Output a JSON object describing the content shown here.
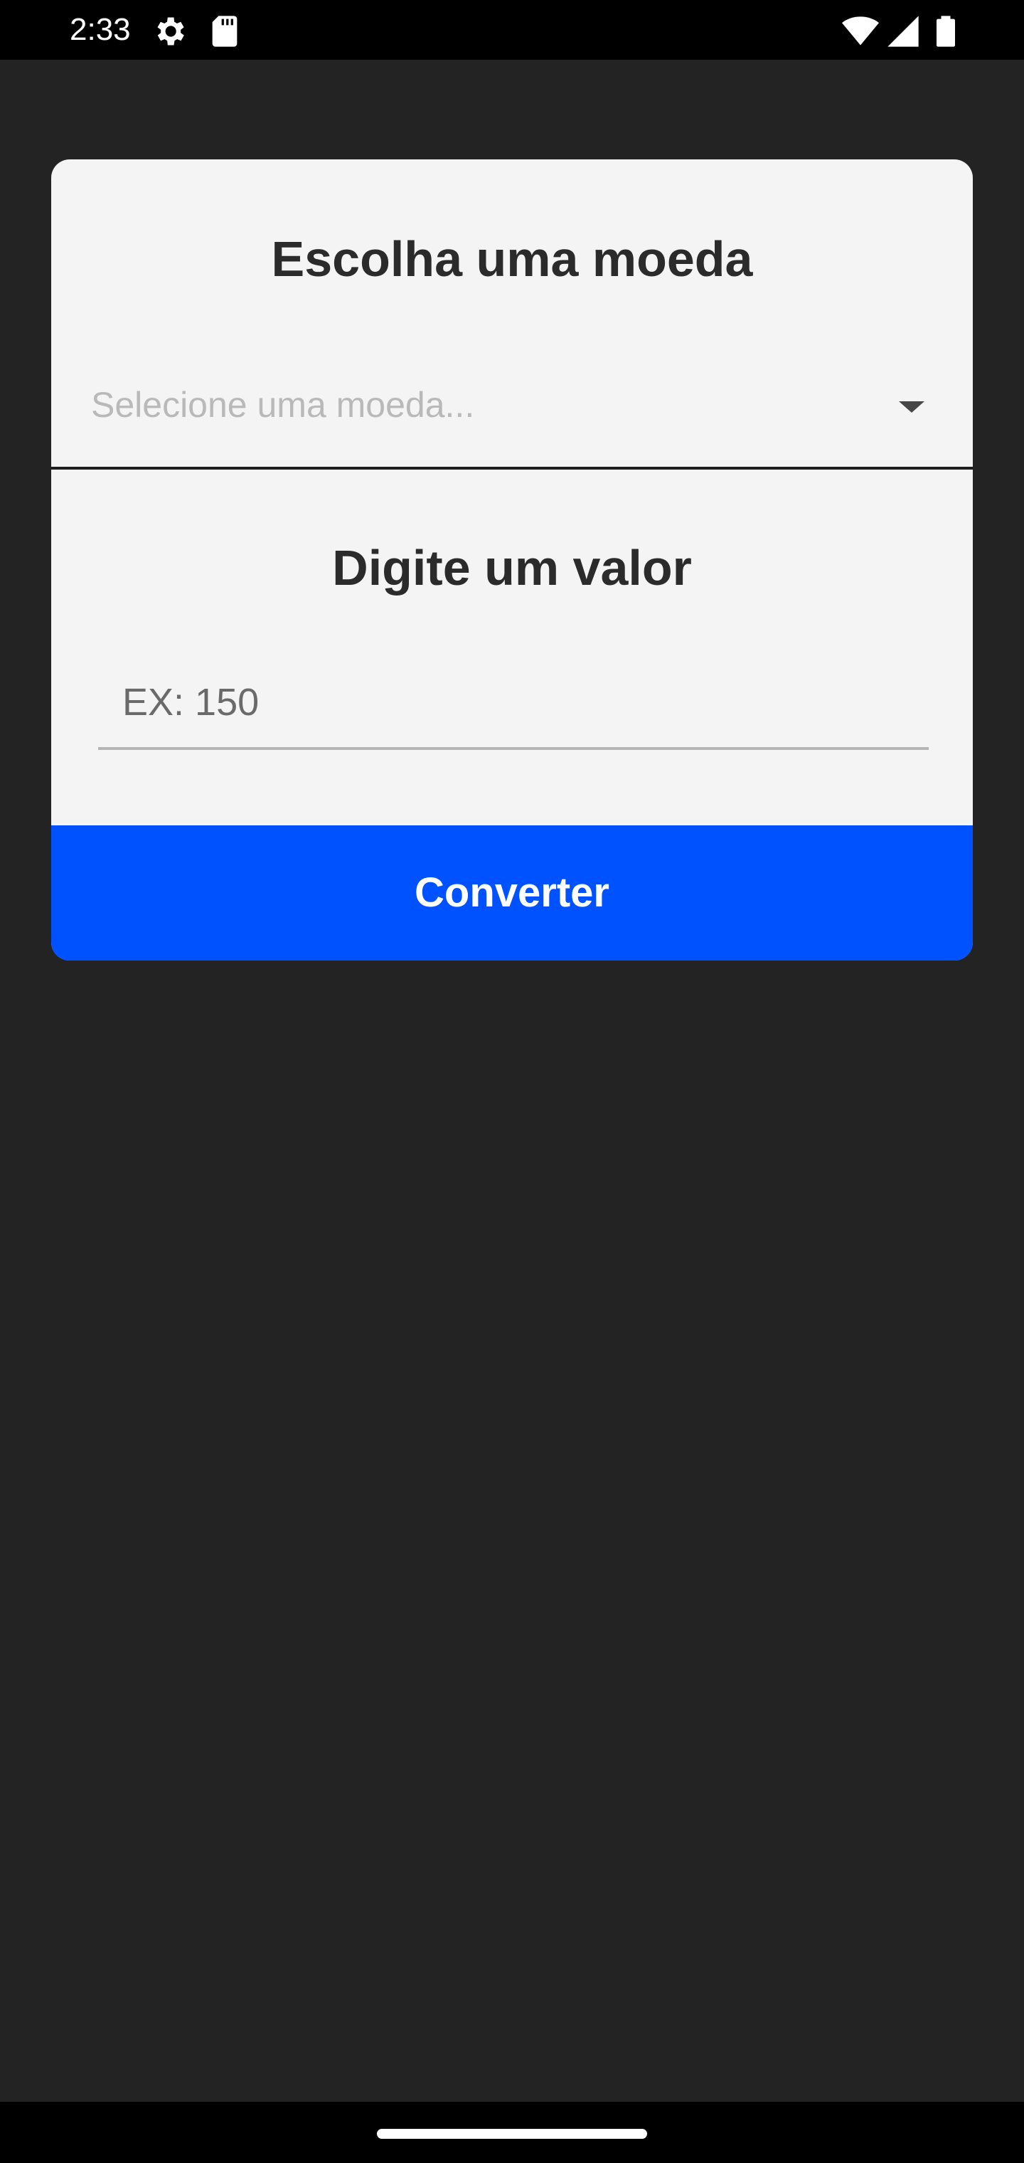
{
  "status_bar": {
    "time": "2:33",
    "icons": [
      "settings-icon",
      "sd-card-icon",
      "wifi-icon",
      "signal-icon",
      "battery-icon"
    ]
  },
  "form": {
    "currency_title": "Escolha uma moeda",
    "currency_select": {
      "placeholder": "Selecione uma moeda...",
      "selected_value": ""
    },
    "value_title": "Digite um valor",
    "value_input": {
      "placeholder": "EX: 150",
      "value": ""
    },
    "convert_label": "Converter"
  },
  "colors": {
    "background": "#232323",
    "card": "#f4f4f4",
    "accent_button": "#0051ff"
  }
}
